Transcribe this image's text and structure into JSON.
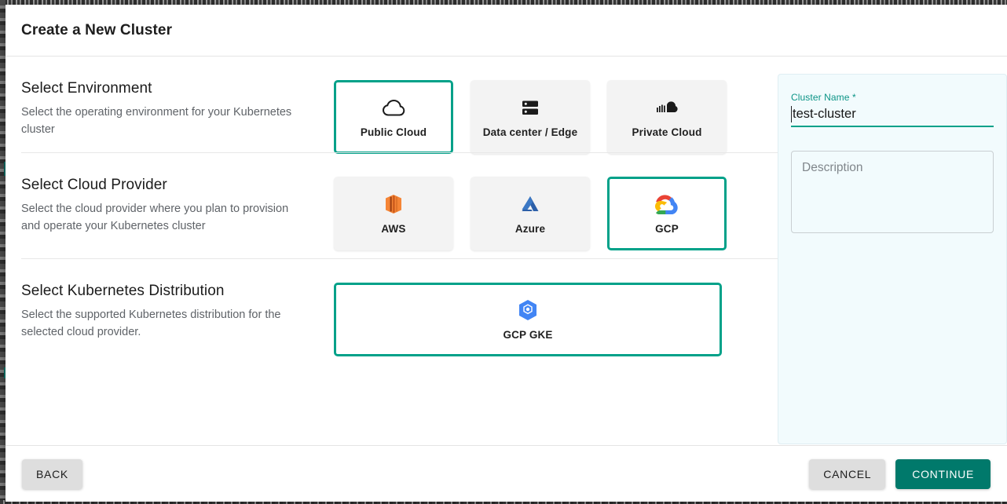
{
  "dialog": {
    "title": "Create a New Cluster"
  },
  "sections": [
    {
      "heading": "Select Environment",
      "description": "Select the operating environment for your Kubernetes cluster",
      "options": [
        {
          "label": "Public Cloud",
          "icon": "cloud-outline-icon",
          "selected": true
        },
        {
          "label": "Data center / Edge",
          "icon": "server-rack-icon",
          "selected": false
        },
        {
          "label": "Private Cloud",
          "icon": "filled-cloud-icon",
          "selected": false
        }
      ]
    },
    {
      "heading": "Select Cloud Provider",
      "description": "Select the cloud provider where you plan to provision and operate your Kubernetes cluster",
      "options": [
        {
          "label": "AWS",
          "icon": "aws-logo-icon",
          "selected": false
        },
        {
          "label": "Azure",
          "icon": "azure-logo-icon",
          "selected": false
        },
        {
          "label": "GCP",
          "icon": "gcp-logo-icon",
          "selected": true
        }
      ]
    },
    {
      "heading": "Select Kubernetes Distribution",
      "description": "Select the supported Kubernetes distribution for the selected cloud provider.",
      "options": [
        {
          "label": "GCP GKE",
          "icon": "gke-hexagon-icon",
          "selected": true
        }
      ]
    }
  ],
  "form": {
    "cluster_name_label": "Cluster Name *",
    "cluster_name_value": "test-cluster",
    "description_placeholder": "Description"
  },
  "footer": {
    "back_label": "BACK",
    "cancel_label": "CANCEL",
    "continue_label": "CONTINUE"
  },
  "colors": {
    "accent_teal": "#00a189",
    "button_teal": "#00796b",
    "panel_tint": "#f2fbfd",
    "label_teal": "#0b9486"
  }
}
